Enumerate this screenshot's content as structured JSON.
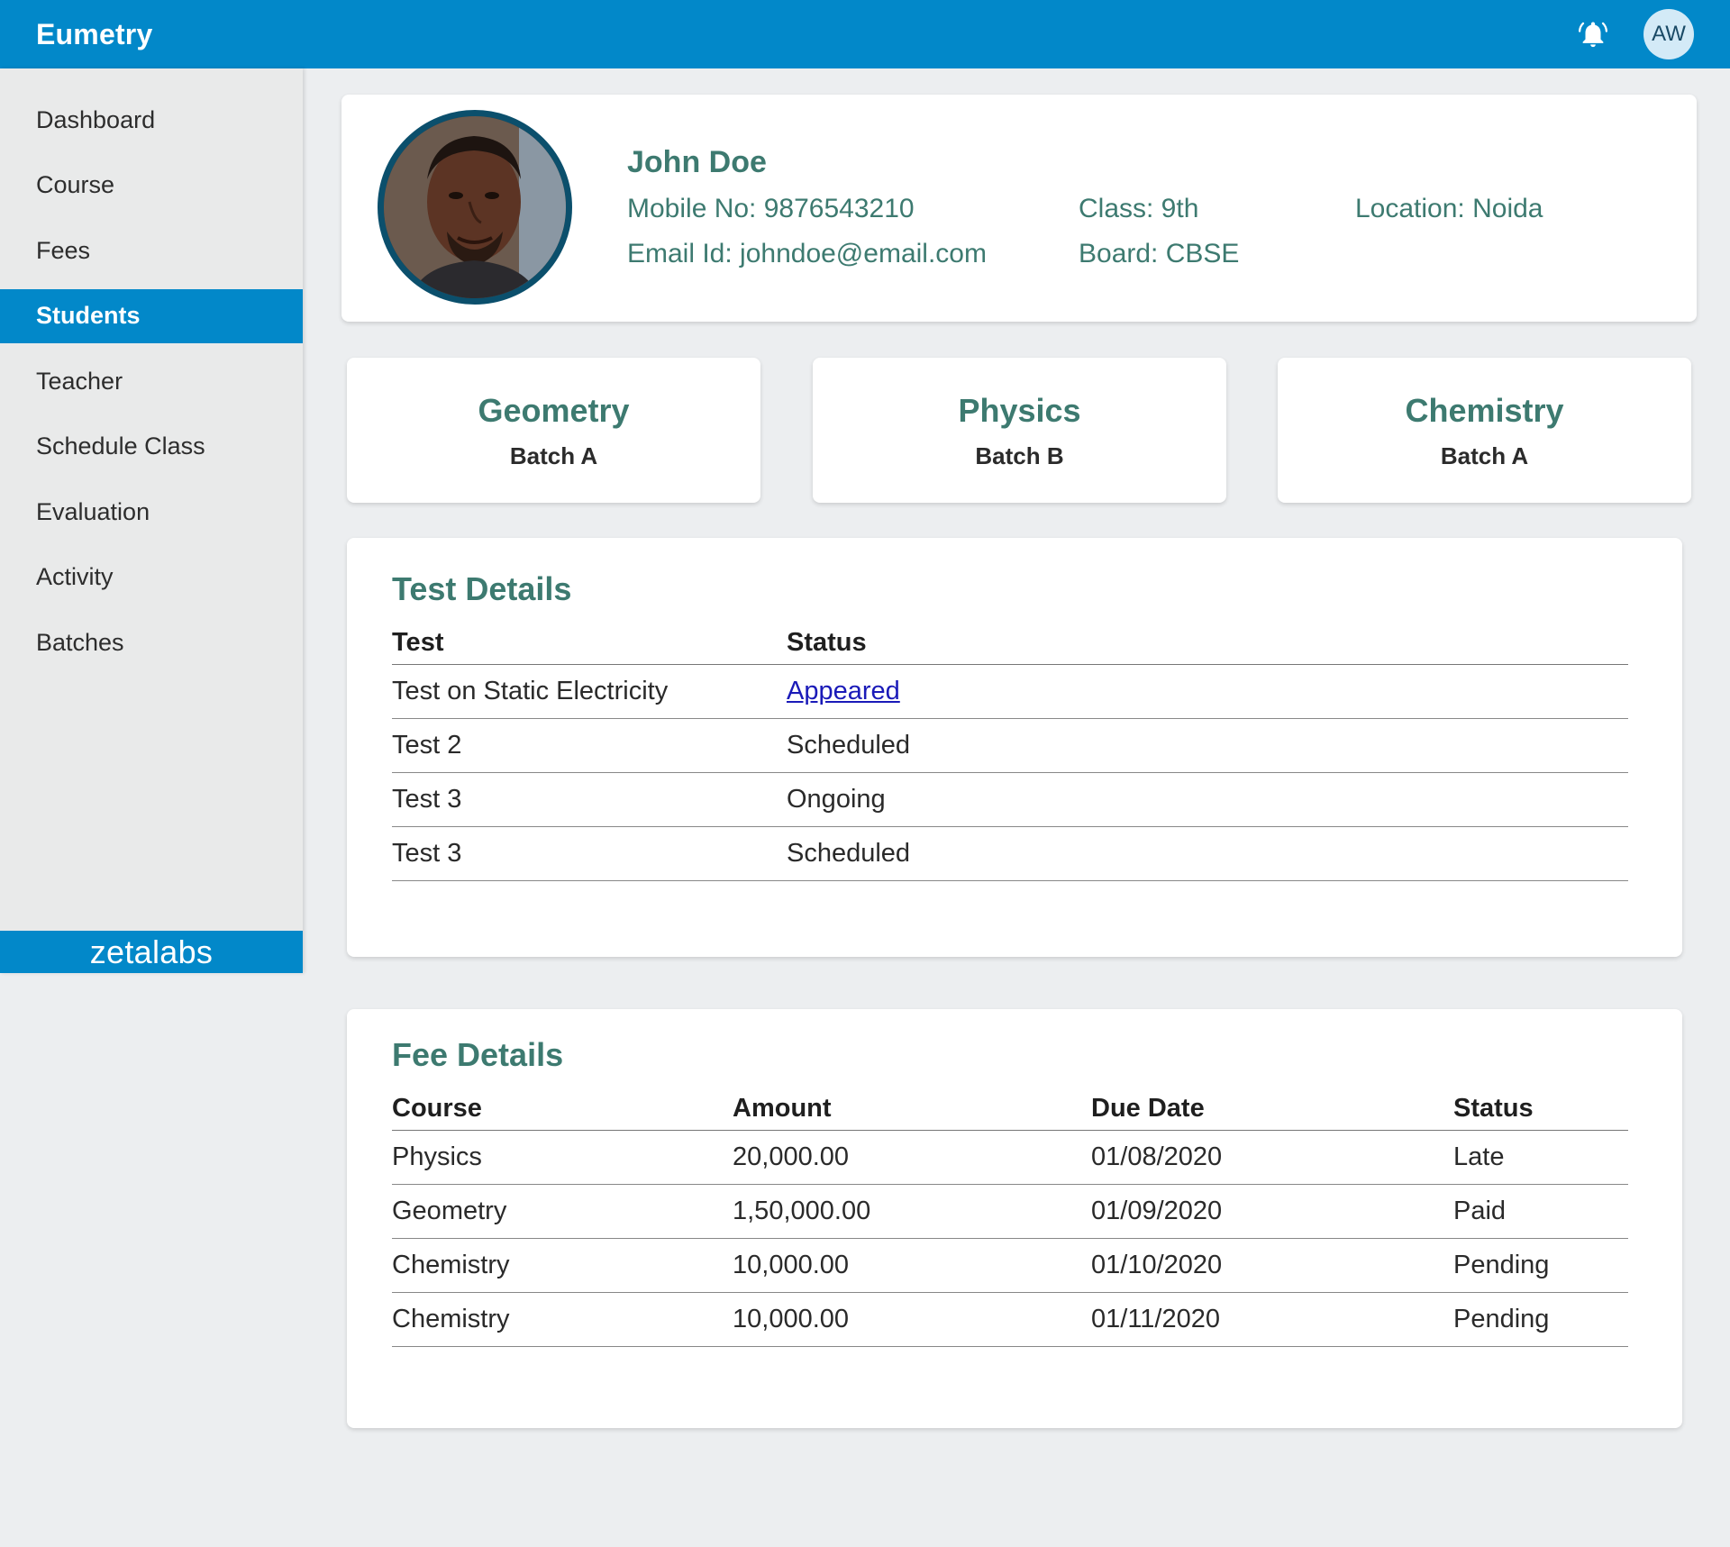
{
  "header": {
    "brand": "Eumetry",
    "avatar_initials": "AW"
  },
  "sidebar": {
    "items": [
      {
        "label": "Dashboard",
        "active": false
      },
      {
        "label": "Course",
        "active": false
      },
      {
        "label": "Fees",
        "active": false
      },
      {
        "label": "Students",
        "active": true
      },
      {
        "label": "Teacher",
        "active": false
      },
      {
        "label": "Schedule Class",
        "active": false
      },
      {
        "label": "Evaluation",
        "active": false
      },
      {
        "label": "Activity",
        "active": false
      },
      {
        "label": "Batches",
        "active": false
      }
    ],
    "footer_logo": "zetalabs"
  },
  "profile": {
    "name": "John Doe",
    "mobile": "Mobile No: 9876543210",
    "email": "Email Id: johndoe@email.com",
    "class": "Class: 9th",
    "board": "Board: CBSE",
    "location": "Location: Noida"
  },
  "subjects": [
    {
      "name": "Geometry",
      "batch": "Batch A"
    },
    {
      "name": "Physics",
      "batch": "Batch B"
    },
    {
      "name": "Chemistry",
      "batch": "Batch A"
    }
  ],
  "test_details": {
    "title": "Test Details",
    "columns": [
      "Test",
      "Status"
    ],
    "rows": [
      [
        "Test on Static Electricity",
        "Appeared"
      ],
      [
        "Test 2",
        "Scheduled"
      ],
      [
        "Test 3",
        "Ongoing"
      ],
      [
        "Test 3",
        "Scheduled"
      ]
    ]
  },
  "fee_details": {
    "title": "Fee Details",
    "columns": [
      "Course",
      "Amount",
      "Due Date",
      "Status"
    ],
    "rows": [
      [
        "Physics",
        "20,000.00",
        "01/08/2020",
        "Late"
      ],
      [
        "Geometry",
        "1,50,000.00",
        "01/09/2020",
        "Paid"
      ],
      [
        "Chemistry",
        "10,000.00",
        "01/10/2020",
        "Pending"
      ],
      [
        "Chemistry",
        "10,000.00",
        "01/11/2020",
        "Pending"
      ]
    ]
  },
  "colors": {
    "primary": "#0288c9",
    "heading": "#3d7a70",
    "link": "#1a1ab8"
  }
}
